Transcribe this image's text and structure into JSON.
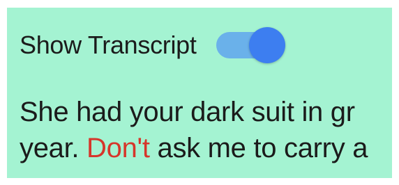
{
  "settings": {
    "show_transcript_label": "Show Transcript",
    "show_transcript_enabled": true
  },
  "transcript": {
    "line1": "She had your dark suit in gr",
    "line2_before": "year. ",
    "line2_highlight": "Don't",
    "line2_after": " ask me to carry a"
  },
  "colors": {
    "panel_background": "#a4f3d2",
    "toggle_track": "#6ab1ea",
    "toggle_thumb": "#3d7ef0",
    "highlight_word": "#d6362b"
  }
}
